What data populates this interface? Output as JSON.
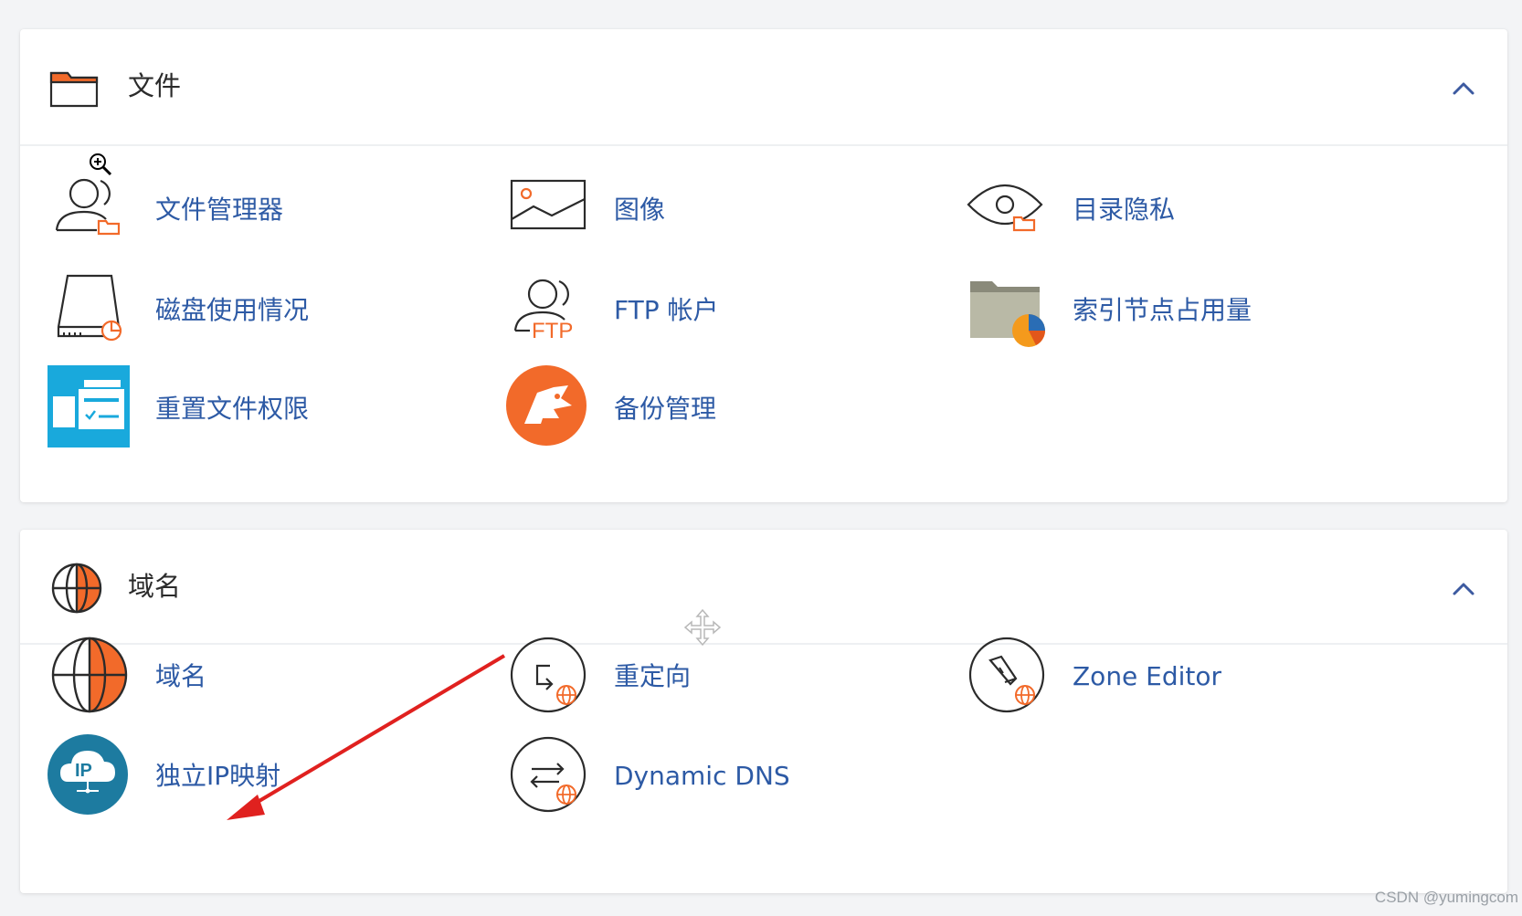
{
  "sections": [
    {
      "title": "文件",
      "header_icon": "folder-icon",
      "items": [
        {
          "label": "文件管理器",
          "icon": "file-manager-icon"
        },
        {
          "label": "图像",
          "icon": "images-icon"
        },
        {
          "label": "目录隐私",
          "icon": "directory-privacy-icon"
        },
        {
          "label": "磁盘使用情况",
          "icon": "disk-usage-icon"
        },
        {
          "label": "FTP 帐户",
          "icon": "ftp-accounts-icon"
        },
        {
          "label": "索引节点占用量",
          "icon": "inode-usage-icon"
        },
        {
          "label": "重置文件权限",
          "icon": "reset-permissions-icon"
        },
        {
          "label": "备份管理",
          "icon": "backup-manager-icon"
        }
      ]
    },
    {
      "title": "域名",
      "header_icon": "globe-icon",
      "items": [
        {
          "label": "域名",
          "icon": "domains-globe-icon"
        },
        {
          "label": "重定向",
          "icon": "redirects-icon"
        },
        {
          "label": "Zone Editor",
          "icon": "zone-editor-icon"
        },
        {
          "label": "独立IP映射",
          "icon": "dedicated-ip-icon"
        },
        {
          "label": "Dynamic DNS",
          "icon": "dynamic-dns-icon"
        }
      ]
    }
  ],
  "ftp_icon_text": "FTP",
  "ip_icon_text": "IP",
  "watermark": "CSDN @yumingcom",
  "colors": {
    "link": "#2d5aa5",
    "accent_orange": "#f26a2a",
    "annotation_arrow": "#e0211f",
    "teal": "#1d7ba0",
    "cyan": "#19a9dc"
  }
}
